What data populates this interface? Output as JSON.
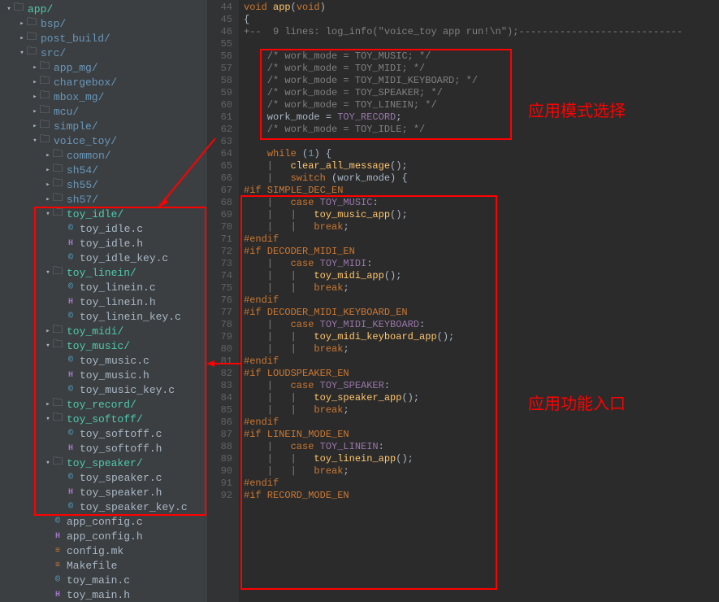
{
  "tree": [
    {
      "d": 0,
      "a": "▾",
      "t": "folder",
      "name": "app/",
      "hl": true
    },
    {
      "d": 1,
      "a": "▸",
      "t": "folder",
      "name": "bsp/"
    },
    {
      "d": 1,
      "a": "▸",
      "t": "folder",
      "name": "post_build/"
    },
    {
      "d": 1,
      "a": "▾",
      "t": "folder",
      "name": "src/"
    },
    {
      "d": 2,
      "a": "▸",
      "t": "folder",
      "name": "app_mg/"
    },
    {
      "d": 2,
      "a": "▸",
      "t": "folder",
      "name": "chargebox/"
    },
    {
      "d": 2,
      "a": "▸",
      "t": "folder",
      "name": "mbox_mg/"
    },
    {
      "d": 2,
      "a": "▸",
      "t": "folder",
      "name": "mcu/"
    },
    {
      "d": 2,
      "a": "▸",
      "t": "folder",
      "name": "simple/"
    },
    {
      "d": 2,
      "a": "▾",
      "t": "folder",
      "name": "voice_toy/"
    },
    {
      "d": 3,
      "a": "▸",
      "t": "folder",
      "name": "common/"
    },
    {
      "d": 3,
      "a": "▸",
      "t": "folder",
      "name": "sh54/"
    },
    {
      "d": 3,
      "a": "▸",
      "t": "folder",
      "name": "sh55/"
    },
    {
      "d": 3,
      "a": "▸",
      "t": "folder",
      "name": "sh57/"
    },
    {
      "d": 3,
      "a": "▾",
      "t": "folder",
      "name": "toy_idle/",
      "hl": true
    },
    {
      "d": 4,
      "a": "",
      "t": "c",
      "name": "toy_idle.c"
    },
    {
      "d": 4,
      "a": "",
      "t": "h",
      "name": "toy_idle.h"
    },
    {
      "d": 4,
      "a": "",
      "t": "c",
      "name": "toy_idle_key.c"
    },
    {
      "d": 3,
      "a": "▾",
      "t": "folder",
      "name": "toy_linein/",
      "hl": true
    },
    {
      "d": 4,
      "a": "",
      "t": "c",
      "name": "toy_linein.c"
    },
    {
      "d": 4,
      "a": "",
      "t": "h",
      "name": "toy_linein.h"
    },
    {
      "d": 4,
      "a": "",
      "t": "c",
      "name": "toy_linein_key.c"
    },
    {
      "d": 3,
      "a": "▸",
      "t": "folder",
      "name": "toy_midi/",
      "hl": true
    },
    {
      "d": 3,
      "a": "▾",
      "t": "folder",
      "name": "toy_music/",
      "hl": true
    },
    {
      "d": 4,
      "a": "",
      "t": "c",
      "name": "toy_music.c"
    },
    {
      "d": 4,
      "a": "",
      "t": "h",
      "name": "toy_music.h"
    },
    {
      "d": 4,
      "a": "",
      "t": "c",
      "name": "toy_music_key.c"
    },
    {
      "d": 3,
      "a": "▸",
      "t": "folder",
      "name": "toy_record/",
      "hl": true
    },
    {
      "d": 3,
      "a": "▾",
      "t": "folder",
      "name": "toy_softoff/",
      "hl": true
    },
    {
      "d": 4,
      "a": "",
      "t": "c",
      "name": "toy_softoff.c"
    },
    {
      "d": 4,
      "a": "",
      "t": "h",
      "name": "toy_softoff.h"
    },
    {
      "d": 3,
      "a": "▾",
      "t": "folder",
      "name": "toy_speaker/",
      "hl": true
    },
    {
      "d": 4,
      "a": "",
      "t": "c",
      "name": "toy_speaker.c"
    },
    {
      "d": 4,
      "a": "",
      "t": "h",
      "name": "toy_speaker.h"
    },
    {
      "d": 4,
      "a": "",
      "t": "c",
      "name": "toy_speaker_key.c"
    },
    {
      "d": 3,
      "a": "",
      "t": "c",
      "name": "app_config.c"
    },
    {
      "d": 3,
      "a": "",
      "t": "h",
      "name": "app_config.h"
    },
    {
      "d": 3,
      "a": "",
      "t": "mk",
      "name": "config.mk"
    },
    {
      "d": 3,
      "a": "",
      "t": "mk",
      "name": "Makefile"
    },
    {
      "d": 3,
      "a": "",
      "t": "c",
      "name": "toy_main.c"
    },
    {
      "d": 3,
      "a": "",
      "t": "h",
      "name": "toy_main.h"
    }
  ],
  "lines": [
    {
      "n": 44,
      "seg": [
        {
          "c": "type",
          "t": "void "
        },
        {
          "c": "fn",
          "t": "app"
        },
        {
          "c": "paren",
          "t": "("
        },
        {
          "c": "type",
          "t": "void"
        },
        {
          "c": "paren",
          "t": ")"
        }
      ]
    },
    {
      "n": 45,
      "seg": [
        {
          "c": "paren",
          "t": "{"
        }
      ]
    },
    {
      "n": 46,
      "seg": [
        {
          "c": "fold",
          "t": "+--  9 lines: log_info(\"voice_toy app run!\\n\");----------------------------"
        }
      ]
    },
    {
      "n": 55,
      "seg": [
        {
          "c": "",
          "t": ""
        }
      ]
    },
    {
      "n": 56,
      "seg": [
        {
          "c": "",
          "t": "    "
        },
        {
          "c": "comment",
          "t": "/* work_mode = TOY_MUSIC; */"
        }
      ]
    },
    {
      "n": 57,
      "seg": [
        {
          "c": "",
          "t": "    "
        },
        {
          "c": "comment",
          "t": "/* work_mode = TOY_MIDI; */"
        }
      ]
    },
    {
      "n": 58,
      "seg": [
        {
          "c": "",
          "t": "    "
        },
        {
          "c": "comment",
          "t": "/* work_mode = TOY_MIDI_KEYBOARD; */"
        }
      ]
    },
    {
      "n": 59,
      "seg": [
        {
          "c": "",
          "t": "    "
        },
        {
          "c": "comment",
          "t": "/* work_mode = TOY_SPEAKER; */"
        }
      ]
    },
    {
      "n": 60,
      "seg": [
        {
          "c": "",
          "t": "    "
        },
        {
          "c": "comment",
          "t": "/* work_mode = TOY_LINEIN; */"
        }
      ]
    },
    {
      "n": 61,
      "seg": [
        {
          "c": "",
          "t": "    work_mode = "
        },
        {
          "c": "enum",
          "t": "TOY_RECORD"
        },
        {
          "c": "",
          "t": ";"
        }
      ]
    },
    {
      "n": 62,
      "seg": [
        {
          "c": "",
          "t": "    "
        },
        {
          "c": "comment",
          "t": "/* work_mode = TOY_IDLE; */"
        }
      ]
    },
    {
      "n": 63,
      "seg": [
        {
          "c": "",
          "t": ""
        }
      ]
    },
    {
      "n": 64,
      "seg": [
        {
          "c": "",
          "t": "    "
        },
        {
          "c": "kw",
          "t": "while"
        },
        {
          "c": "",
          "t": " ("
        },
        {
          "c": "num",
          "t": "1"
        },
        {
          "c": "",
          "t": ") {"
        }
      ]
    },
    {
      "n": 65,
      "seg": [
        {
          "c": "comment",
          "t": "    |   "
        },
        {
          "c": "fn",
          "t": "clear_all_message"
        },
        {
          "c": "",
          "t": "();"
        }
      ]
    },
    {
      "n": 66,
      "seg": [
        {
          "c": "comment",
          "t": "    |   "
        },
        {
          "c": "kw",
          "t": "switch"
        },
        {
          "c": "",
          "t": " (work_mode) {"
        }
      ]
    },
    {
      "n": 67,
      "seg": [
        {
          "c": "pp",
          "t": "#if SIMPLE_DEC_EN"
        }
      ]
    },
    {
      "n": 68,
      "seg": [
        {
          "c": "comment",
          "t": "    |   "
        },
        {
          "c": "kw",
          "t": "case"
        },
        {
          "c": "",
          "t": " "
        },
        {
          "c": "enum",
          "t": "TOY_MUSIC"
        },
        {
          "c": "",
          "t": ":"
        }
      ]
    },
    {
      "n": 69,
      "seg": [
        {
          "c": "comment",
          "t": "    |   |   "
        },
        {
          "c": "fn",
          "t": "toy_music_app"
        },
        {
          "c": "",
          "t": "();"
        }
      ]
    },
    {
      "n": 70,
      "seg": [
        {
          "c": "comment",
          "t": "    |   |   "
        },
        {
          "c": "kw",
          "t": "break"
        },
        {
          "c": "",
          "t": ";"
        }
      ]
    },
    {
      "n": 71,
      "seg": [
        {
          "c": "pp",
          "t": "#endif"
        }
      ]
    },
    {
      "n": 72,
      "seg": [
        {
          "c": "pp",
          "t": "#if DECODER_MIDI_EN"
        }
      ]
    },
    {
      "n": 73,
      "seg": [
        {
          "c": "comment",
          "t": "    |   "
        },
        {
          "c": "kw",
          "t": "case"
        },
        {
          "c": "",
          "t": " "
        },
        {
          "c": "enum",
          "t": "TOY_MIDI"
        },
        {
          "c": "",
          "t": ":"
        }
      ]
    },
    {
      "n": 74,
      "seg": [
        {
          "c": "comment",
          "t": "    |   |   "
        },
        {
          "c": "fn",
          "t": "toy_midi_app"
        },
        {
          "c": "",
          "t": "();"
        }
      ]
    },
    {
      "n": 75,
      "seg": [
        {
          "c": "comment",
          "t": "    |   |   "
        },
        {
          "c": "kw",
          "t": "break"
        },
        {
          "c": "",
          "t": ";"
        }
      ]
    },
    {
      "n": 76,
      "seg": [
        {
          "c": "pp",
          "t": "#endif"
        }
      ]
    },
    {
      "n": 77,
      "seg": [
        {
          "c": "pp",
          "t": "#if DECODER_MIDI_KEYBOARD_EN"
        }
      ]
    },
    {
      "n": 78,
      "seg": [
        {
          "c": "comment",
          "t": "    |   "
        },
        {
          "c": "kw",
          "t": "case"
        },
        {
          "c": "",
          "t": " "
        },
        {
          "c": "enum",
          "t": "TOY_MIDI_KEYBOARD"
        },
        {
          "c": "",
          "t": ":"
        }
      ]
    },
    {
      "n": 79,
      "seg": [
        {
          "c": "comment",
          "t": "    |   |   "
        },
        {
          "c": "fn",
          "t": "toy_midi_keyboard_app"
        },
        {
          "c": "",
          "t": "();"
        }
      ]
    },
    {
      "n": 80,
      "seg": [
        {
          "c": "comment",
          "t": "    |   |   "
        },
        {
          "c": "kw",
          "t": "break"
        },
        {
          "c": "",
          "t": ";"
        }
      ]
    },
    {
      "n": 81,
      "seg": [
        {
          "c": "pp",
          "t": "#endif"
        }
      ]
    },
    {
      "n": 82,
      "seg": [
        {
          "c": "pp",
          "t": "#if LOUDSPEAKER_EN"
        }
      ]
    },
    {
      "n": 83,
      "seg": [
        {
          "c": "comment",
          "t": "    |   "
        },
        {
          "c": "kw",
          "t": "case"
        },
        {
          "c": "",
          "t": " "
        },
        {
          "c": "enum",
          "t": "TOY_SPEAKER"
        },
        {
          "c": "",
          "t": ":"
        }
      ]
    },
    {
      "n": 84,
      "seg": [
        {
          "c": "comment",
          "t": "    |   |   "
        },
        {
          "c": "fn",
          "t": "toy_speaker_app"
        },
        {
          "c": "",
          "t": "();"
        }
      ]
    },
    {
      "n": 85,
      "seg": [
        {
          "c": "comment",
          "t": "    |   |   "
        },
        {
          "c": "kw",
          "t": "break"
        },
        {
          "c": "",
          "t": ";"
        }
      ]
    },
    {
      "n": 86,
      "seg": [
        {
          "c": "pp",
          "t": "#endif"
        }
      ]
    },
    {
      "n": 87,
      "seg": [
        {
          "c": "pp",
          "t": "#if LINEIN_MODE_EN"
        }
      ]
    },
    {
      "n": 88,
      "seg": [
        {
          "c": "comment",
          "t": "    |   "
        },
        {
          "c": "kw",
          "t": "case"
        },
        {
          "c": "",
          "t": " "
        },
        {
          "c": "enum",
          "t": "TOY_LINEIN"
        },
        {
          "c": "",
          "t": ":"
        }
      ]
    },
    {
      "n": 89,
      "seg": [
        {
          "c": "comment",
          "t": "    |   |   "
        },
        {
          "c": "fn",
          "t": "toy_linein_app"
        },
        {
          "c": "",
          "t": "();"
        }
      ]
    },
    {
      "n": 90,
      "seg": [
        {
          "c": "comment",
          "t": "    |   |   "
        },
        {
          "c": "kw",
          "t": "break"
        },
        {
          "c": "",
          "t": ";"
        }
      ]
    },
    {
      "n": 91,
      "seg": [
        {
          "c": "pp",
          "t": "#endif"
        }
      ]
    },
    {
      "n": 92,
      "seg": [
        {
          "c": "pp",
          "t": "#if RECORD_MODE_EN"
        }
      ]
    }
  ],
  "annotations": {
    "label1": "应用模式选择",
    "label2": "应用功能入口"
  }
}
